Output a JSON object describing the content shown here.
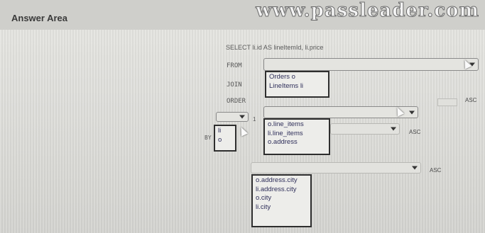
{
  "header": {
    "title": "Answer Area"
  },
  "watermark": "www.passleader.com",
  "sql": {
    "select_line": "SELECT li.id AS lineItemId, li.price",
    "from_kw": "FROM",
    "join_kw": "JOIN",
    "order_kw": "ORDER",
    "order_by_kw": "BY",
    "order_num": "1",
    "asc_label": "ASC"
  },
  "from_options": [
    "Orders o",
    "LineItems li"
  ],
  "alias_options": [
    "li",
    "o"
  ],
  "join_field_options": [
    "o.line_items",
    "li.line_items",
    "o.address"
  ],
  "order_options": [
    "o.address.city",
    "li.address.city",
    "o.city",
    "li.city"
  ]
}
